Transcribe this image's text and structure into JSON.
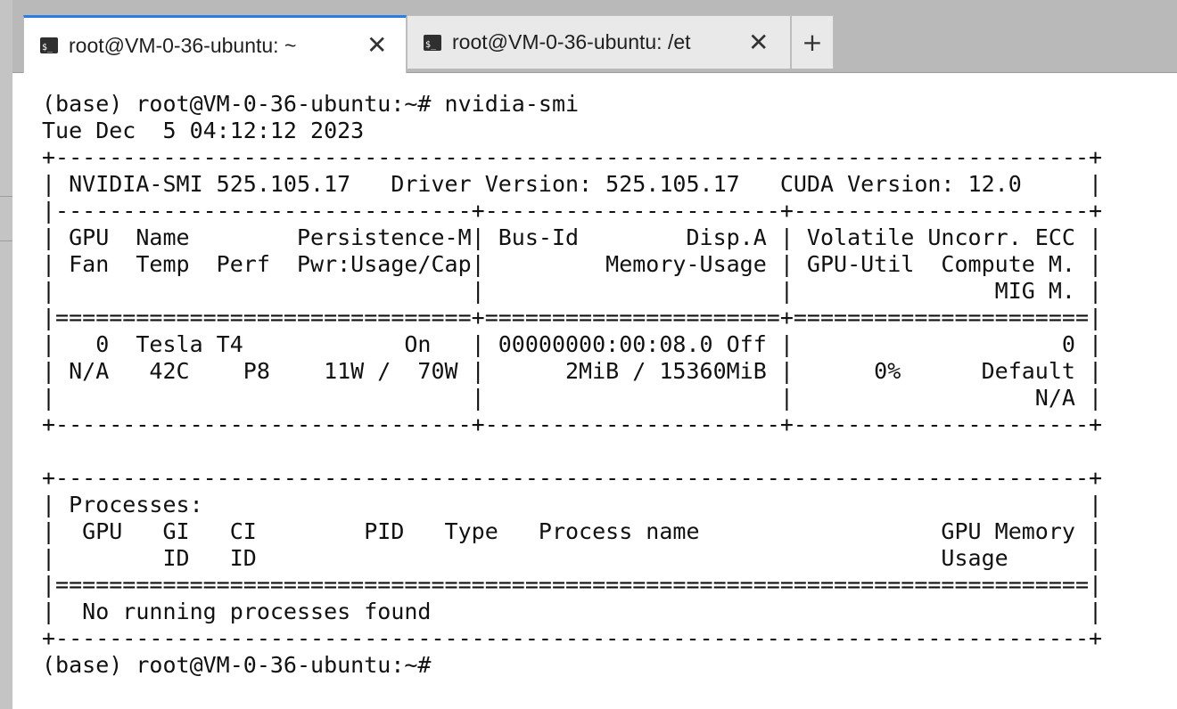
{
  "tabs": [
    {
      "title": "root@VM-0-36-ubuntu: ~",
      "icon": "terminal-icon",
      "active": true
    },
    {
      "title": "root@VM-0-36-ubuntu: /et",
      "icon": "terminal-icon",
      "active": false
    }
  ],
  "glyphs": {
    "close": "✕",
    "new_tab": "+",
    "terminal_icon": "$_"
  },
  "terminal": {
    "lines": [
      "(base) root@VM-0-36-ubuntu:~# nvidia-smi",
      "Tue Dec  5 04:12:12 2023",
      "+-----------------------------------------------------------------------------+",
      "| NVIDIA-SMI 525.105.17   Driver Version: 525.105.17   CUDA Version: 12.0     |",
      "|-------------------------------+----------------------+----------------------+",
      "| GPU  Name        Persistence-M| Bus-Id        Disp.A | Volatile Uncorr. ECC |",
      "| Fan  Temp  Perf  Pwr:Usage/Cap|         Memory-Usage | GPU-Util  Compute M. |",
      "|                               |                      |               MIG M. |",
      "|===============================+======================+======================|",
      "|   0  Tesla T4            On   | 00000000:00:08.0 Off |                    0 |",
      "| N/A   42C    P8    11W /  70W |      2MiB / 15360MiB |      0%      Default |",
      "|                               |                      |                  N/A |",
      "+-------------------------------+----------------------+----------------------+",
      "",
      "+-----------------------------------------------------------------------------+",
      "| Processes:                                                                  |",
      "|  GPU   GI   CI        PID   Type   Process name                  GPU Memory |",
      "|        ID   ID                                                   Usage      |",
      "|=============================================================================|",
      "|  No running processes found                                                 |",
      "+-----------------------------------------------------------------------------+",
      "(base) root@VM-0-36-ubuntu:~#"
    ]
  },
  "colors": {
    "tab_active_accent": "#2a7de1",
    "tabbar_bg": "#b9b9b9",
    "terminal_bg": "#ffffff",
    "terminal_fg": "#111111"
  }
}
